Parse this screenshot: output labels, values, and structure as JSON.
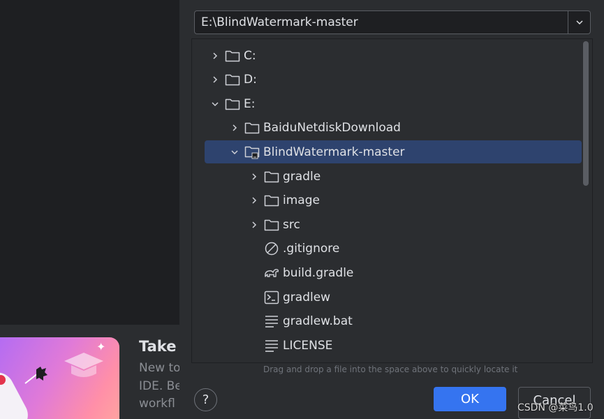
{
  "background": {
    "promo": {
      "title": "Take",
      "lines": [
        "New to",
        "IDE. Be",
        "workfl"
      ]
    }
  },
  "dialog": {
    "path_value": "E:\\BlindWatermark-master",
    "tree": [
      {
        "label": "C:",
        "depth": 0,
        "expanded": false,
        "icon": "folder-icon",
        "has_chevron": true
      },
      {
        "label": "D:",
        "depth": 0,
        "expanded": false,
        "icon": "folder-icon",
        "has_chevron": true
      },
      {
        "label": "E:",
        "depth": 0,
        "expanded": true,
        "icon": "folder-icon",
        "has_chevron": true
      },
      {
        "label": "BaiduNetdiskDownload",
        "depth": 1,
        "expanded": false,
        "icon": "folder-icon",
        "has_chevron": true
      },
      {
        "label": "BlindWatermark-master",
        "depth": 1,
        "expanded": true,
        "icon": "project-folder-icon",
        "has_chevron": true,
        "selected": true
      },
      {
        "label": "gradle",
        "depth": 2,
        "expanded": false,
        "icon": "folder-icon",
        "has_chevron": true
      },
      {
        "label": "image",
        "depth": 2,
        "expanded": false,
        "icon": "folder-icon",
        "has_chevron": true
      },
      {
        "label": "src",
        "depth": 2,
        "expanded": false,
        "icon": "folder-icon",
        "has_chevron": true
      },
      {
        "label": ".gitignore",
        "depth": 2,
        "icon": "ignore-file-icon",
        "has_chevron": false
      },
      {
        "label": "build.gradle",
        "depth": 2,
        "icon": "gradle-icon",
        "has_chevron": false
      },
      {
        "label": "gradlew",
        "depth": 2,
        "icon": "terminal-file-icon",
        "has_chevron": false
      },
      {
        "label": "gradlew.bat",
        "depth": 2,
        "icon": "text-file-icon",
        "has_chevron": false
      },
      {
        "label": "LICENSE",
        "depth": 2,
        "icon": "text-file-icon",
        "has_chevron": false
      }
    ],
    "hint": "Drag and drop a file into the space above to quickly locate it",
    "help_label": "?",
    "ok_label": "OK",
    "cancel_label": "Cancel"
  },
  "watermark": "CSDN @菜鸟1.0",
  "colors": {
    "accent": "#3574f0",
    "selection": "#2e436e",
    "dialog_bg": "#2b2d30",
    "window_bg": "#1e1f22"
  }
}
